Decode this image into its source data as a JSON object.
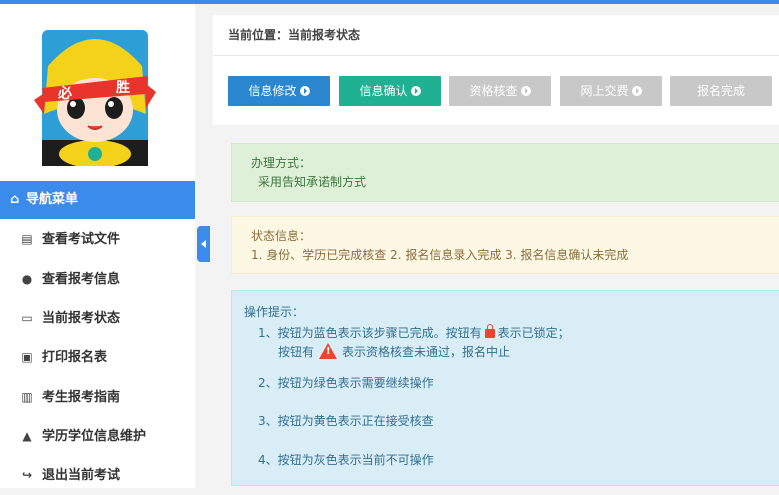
{
  "avatar_text": {
    "left": "必",
    "right": "胜"
  },
  "nav": {
    "header": "导航菜单",
    "items": [
      {
        "label": "查看考试文件",
        "icon": "file-icon"
      },
      {
        "label": "查看报考信息",
        "icon": "info-icon"
      },
      {
        "label": "当前报考状态",
        "icon": "monitor-icon"
      },
      {
        "label": "打印报名表",
        "icon": "print-icon"
      },
      {
        "label": "考生报考指南",
        "icon": "book-icon"
      },
      {
        "label": "学历学位信息维护",
        "icon": "graduation-cap-icon"
      },
      {
        "label": "退出当前考试",
        "icon": "sign-out-icon"
      }
    ]
  },
  "breadcrumb": "当前位置：当前报考状态",
  "steps": [
    {
      "label": "信息修改",
      "color": "#2a86cf"
    },
    {
      "label": "信息确认",
      "color": "#1fb191"
    },
    {
      "label": "资格核查",
      "color": "#c8c8c8"
    },
    {
      "label": "网上交费",
      "color": "#c8c8c8"
    },
    {
      "label": "报名完成",
      "color": "#c8c8c8"
    }
  ],
  "method": {
    "title": "办理方式：",
    "content": "采用告知承诺制方式"
  },
  "status": {
    "title": "状态信息：",
    "content": "1. 身份、学历已完成核查 2. 报名信息录入完成 3. 报名信息确认未完成"
  },
  "tips": {
    "title": "操作提示：",
    "line1_a": "1、按钮为蓝色表示该步骤已完成。按钮有",
    "line1_b": "表示已锁定；",
    "line1c_a": "按钮有",
    "line1c_b": "表示资格核查未通过，报名中止",
    "line2": "2、按钮为绿色表示需要继续操作",
    "line3": "3、按钮为黄色表示正在接受核查",
    "line4": "4、按钮为灰色表示当前不可操作"
  }
}
